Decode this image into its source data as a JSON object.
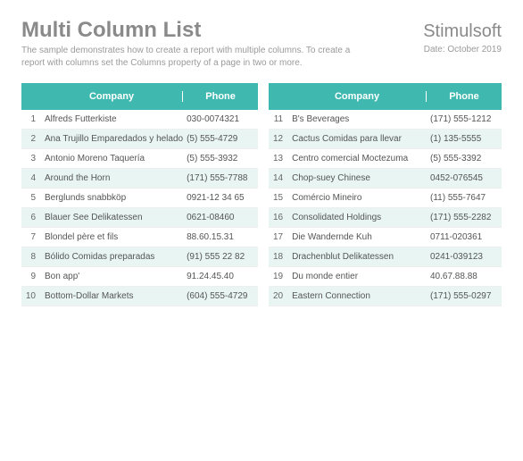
{
  "header": {
    "title": "Multi Column List",
    "brand": "Stimulsoft",
    "description": "The sample demonstrates how to create a report with multiple columns. To create a report with columns set the Columns property of a page in two or more.",
    "date": "Date: October 2019"
  },
  "table": {
    "columns": {
      "company": "Company",
      "phone": "Phone"
    }
  },
  "chart_data": {
    "type": "table",
    "title": "Multi Column List",
    "columns": [
      "#",
      "Company",
      "Phone"
    ],
    "left": [
      {
        "n": "1",
        "company": "Alfreds Futterkiste",
        "phone": "030-0074321"
      },
      {
        "n": "2",
        "company": "Ana Trujillo Emparedados y helado",
        "phone": "(5) 555-4729"
      },
      {
        "n": "3",
        "company": "Antonio Moreno Taquería",
        "phone": "(5) 555-3932"
      },
      {
        "n": "4",
        "company": "Around the Horn",
        "phone": "(171) 555-7788"
      },
      {
        "n": "5",
        "company": "Berglunds snabbköp",
        "phone": "0921-12 34 65"
      },
      {
        "n": "6",
        "company": "Blauer See Delikatessen",
        "phone": "0621-08460"
      },
      {
        "n": "7",
        "company": "Blondel père et fils",
        "phone": "88.60.15.31"
      },
      {
        "n": "8",
        "company": "Bólido Comidas preparadas",
        "phone": "(91) 555 22 82"
      },
      {
        "n": "9",
        "company": "Bon app'",
        "phone": "91.24.45.40"
      },
      {
        "n": "10",
        "company": "Bottom-Dollar Markets",
        "phone": "(604) 555-4729"
      }
    ],
    "right": [
      {
        "n": "11",
        "company": "B's Beverages",
        "phone": "(171) 555-1212"
      },
      {
        "n": "12",
        "company": "Cactus Comidas para llevar",
        "phone": "(1) 135-5555"
      },
      {
        "n": "13",
        "company": "Centro comercial Moctezuma",
        "phone": "(5) 555-3392"
      },
      {
        "n": "14",
        "company": "Chop-suey Chinese",
        "phone": "0452-076545"
      },
      {
        "n": "15",
        "company": "Comércio Mineiro",
        "phone": "(11) 555-7647"
      },
      {
        "n": "16",
        "company": "Consolidated Holdings",
        "phone": "(171) 555-2282"
      },
      {
        "n": "17",
        "company": "Die Wandernde Kuh",
        "phone": "0711-020361"
      },
      {
        "n": "18",
        "company": "Drachenblut Delikatessen",
        "phone": "0241-039123"
      },
      {
        "n": "19",
        "company": "Du monde entier",
        "phone": "40.67.88.88"
      },
      {
        "n": "20",
        "company": "Eastern Connection",
        "phone": "(171) 555-0297"
      }
    ]
  }
}
